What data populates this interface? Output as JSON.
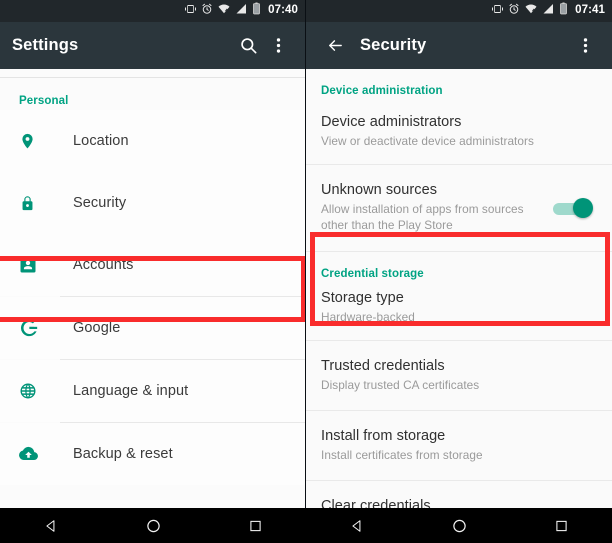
{
  "left": {
    "statusbar": {
      "time": "07:40",
      "icons": [
        "vibrate-icon",
        "alarm-icon",
        "wifi-icon",
        "signal-icon",
        "battery-icon"
      ]
    },
    "appbar": {
      "title": "Settings",
      "search_icon": "search-icon",
      "overflow_icon": "more-vert-icon"
    },
    "section_header": "Personal",
    "items": [
      {
        "label": "Location",
        "icon": "location-pin-icon"
      },
      {
        "label": "Security",
        "icon": "lock-icon"
      },
      {
        "label": "Accounts",
        "icon": "account-box-icon"
      },
      {
        "label": "Google",
        "icon": "google-g-icon"
      },
      {
        "label": "Language & input",
        "icon": "globe-icon"
      },
      {
        "label": "Backup & reset",
        "icon": "cloud-upload-icon"
      }
    ]
  },
  "right": {
    "statusbar": {
      "time": "07:41",
      "icons": [
        "vibrate-icon",
        "alarm-icon",
        "wifi-icon",
        "signal-icon",
        "battery-icon"
      ]
    },
    "appbar": {
      "back_icon": "arrow-back-icon",
      "title": "Security",
      "overflow_icon": "more-vert-icon"
    },
    "sections": [
      {
        "header": "Device administration",
        "items": [
          {
            "title": "Device administrators",
            "subtitle": "View or deactivate device administrators",
            "toggle": null
          },
          {
            "title": "Unknown sources",
            "subtitle": "Allow installation of apps from sources other than the Play Store",
            "toggle": "on"
          }
        ]
      },
      {
        "header": "Credential storage",
        "items": [
          {
            "title": "Storage type",
            "subtitle": "Hardware-backed",
            "toggle": null
          },
          {
            "title": "Trusted credentials",
            "subtitle": "Display trusted CA certificates",
            "toggle": null
          },
          {
            "title": "Install from storage",
            "subtitle": "Install certificates from storage",
            "toggle": null
          },
          {
            "title": "Clear credentials",
            "subtitle": "",
            "toggle": null
          }
        ]
      }
    ]
  },
  "navbar": {
    "back": "nav-back-icon",
    "home": "nav-home-icon",
    "recents": "nav-recents-icon"
  },
  "highlights": [
    {
      "name": "security-row-highlight",
      "color": "#f92c2c"
    },
    {
      "name": "unknown-sources-highlight",
      "color": "#f92c2c"
    }
  ],
  "colors": {
    "accent": "#00a383",
    "statusbar": "#21272b",
    "appbar": "#2b363c",
    "highlight": "#f92c2c",
    "toggle_on": "#009478"
  }
}
